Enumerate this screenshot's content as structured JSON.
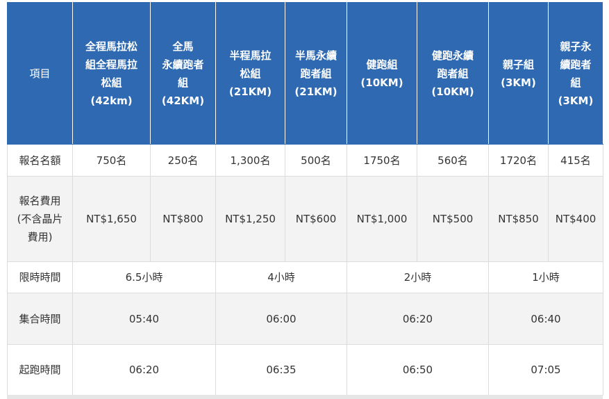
{
  "header": {
    "item_label": "項目",
    "columns": [
      {
        "name": "全程馬拉松組全程馬拉松組",
        "lines": [
          "全程馬拉松",
          "組全程馬拉",
          "松組",
          "(42km)"
        ]
      },
      {
        "name": "全馬永續跑者組",
        "lines": [
          "全馬",
          "永續跑者",
          "組",
          "(42KM)"
        ]
      },
      {
        "name": "半程馬拉松組",
        "lines": [
          "半程馬拉",
          "松組",
          "(21KM)"
        ]
      },
      {
        "name": "半馬永續跑者組",
        "lines": [
          "半馬永續",
          "跑者組",
          "(21KM)"
        ]
      },
      {
        "name": "健跑組",
        "lines": [
          "健跑組",
          "(10KM)"
        ]
      },
      {
        "name": "健跑永續跑者組",
        "lines": [
          "健跑永續",
          "跑者組",
          "(10KM)"
        ]
      },
      {
        "name": "親子組",
        "lines": [
          "親子組",
          "(3KM)"
        ]
      },
      {
        "name": "親子永續跑者組",
        "lines": [
          "親子永",
          "續跑者",
          "組",
          "(3KM)"
        ]
      }
    ]
  },
  "rows": {
    "quota": {
      "label": "報名名額",
      "values": [
        "750名",
        "250名",
        "1,300名",
        "500名",
        "1750名",
        "560名",
        "1720名",
        "415名"
      ]
    },
    "fee": {
      "label_lines": [
        "報名費用",
        "(不含晶片",
        "費用)"
      ],
      "values": [
        "NT$1,650",
        "NT$800",
        "NT$1,250",
        "NT$600",
        "NT$1,000",
        "NT$500",
        "NT$850",
        "NT$400"
      ]
    },
    "time_limit": {
      "label": "限時時間",
      "values": [
        "6.5小時",
        "4小時",
        "2小時",
        "1小時"
      ]
    },
    "gather": {
      "label": "集合時間",
      "values": [
        "05:40",
        "06:00",
        "06:20",
        "06:40"
      ]
    },
    "start": {
      "label": "起跑時間",
      "values": [
        "06:20",
        "06:35",
        "06:50",
        "07:05"
      ]
    }
  },
  "colors": {
    "header_bg": "#2e69b1",
    "header_text": "#ffffff",
    "body_text": "#333333",
    "grey_row": "#f3f3f3"
  }
}
